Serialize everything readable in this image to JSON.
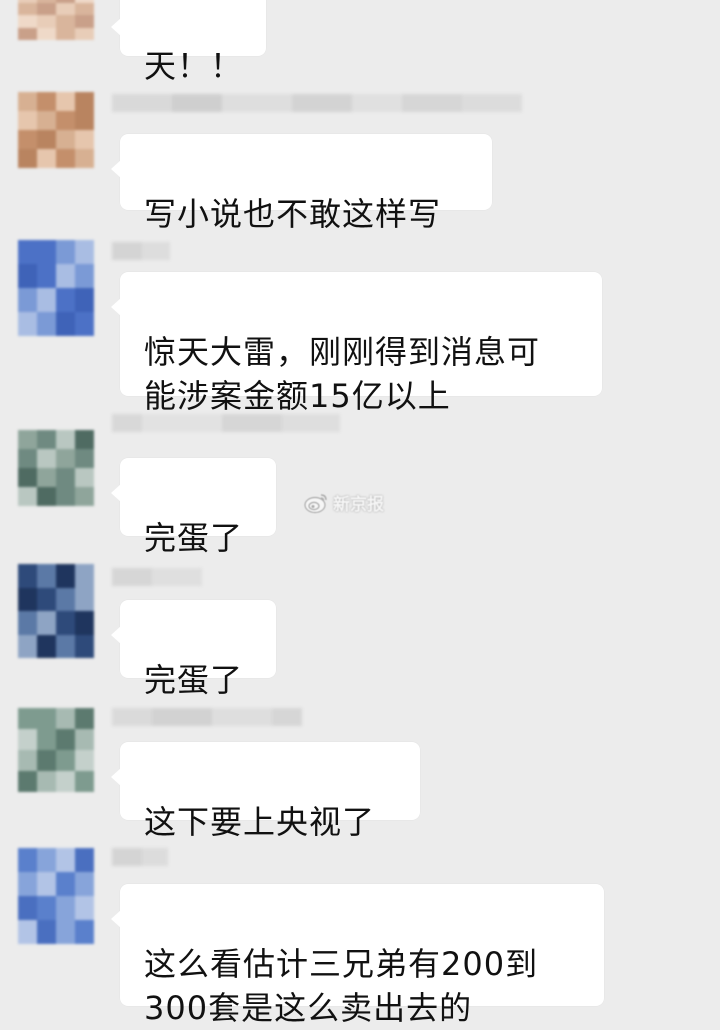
{
  "chat": {
    "messages": [
      {
        "text": "天！！",
        "avatar_palette": [
          "#e8cdb8",
          "#d9b59c",
          "#c9a089",
          "#efd9c8"
        ]
      },
      {
        "text": "写小说也不敢这样写",
        "avatar_palette": [
          "#d7b092",
          "#c48f6b",
          "#e6c6ad",
          "#b98460"
        ]
      },
      {
        "text": "惊天大雷，刚刚得到消息可\n能涉案金额15亿以上",
        "avatar_palette": [
          "#4c71c6",
          "#7b9ad6",
          "#a9bde3",
          "#3f63b8"
        ]
      },
      {
        "text": "完蛋了",
        "avatar_palette": [
          "#8fa59b",
          "#6f8a81",
          "#b9c7c1",
          "#4f6b62"
        ]
      },
      {
        "text": "完蛋了",
        "avatar_palette": [
          "#2e4a7a",
          "#5b79a6",
          "#1f355e",
          "#8ea4c4"
        ]
      },
      {
        "text": "这下要上央视了",
        "avatar_palette": [
          "#7e9b8f",
          "#a7bab2",
          "#5c7a6f",
          "#c4d0cb"
        ]
      },
      {
        "text": "这么看估计三兄弟有200到\n300套是这么卖出去的",
        "avatar_palette": [
          "#5a80cc",
          "#87a4da",
          "#b2c4e6",
          "#4a6fc0"
        ]
      }
    ]
  },
  "watermark": {
    "text": "新京报",
    "icon": "weibo-logo-icon"
  },
  "colors": {
    "background": "#ececec",
    "bubble": "#ffffff",
    "text": "#111111"
  }
}
